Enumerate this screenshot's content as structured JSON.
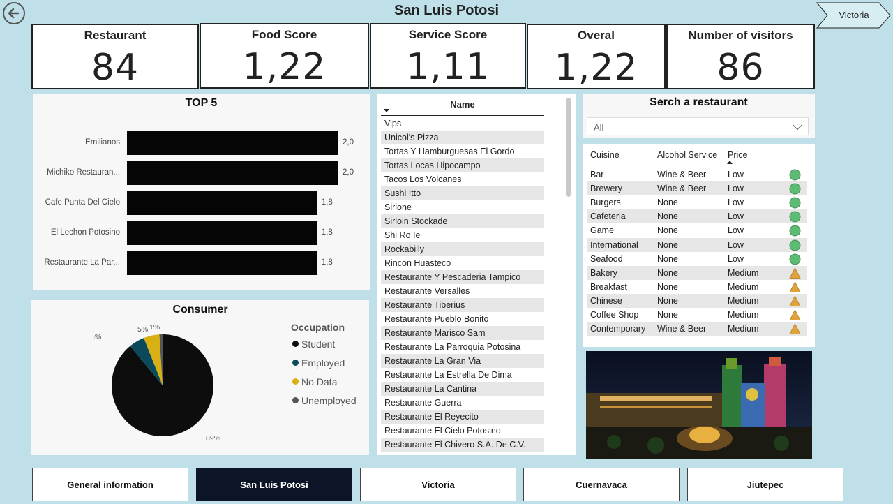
{
  "header": {
    "title": "San Luis Potosi",
    "nav_label": "Victoria"
  },
  "kpis": [
    {
      "label": "Restaurant",
      "value": "84"
    },
    {
      "label": "Food Score",
      "value": "1,22"
    },
    {
      "label": "Service Score",
      "value": "1,11"
    },
    {
      "label": "Overal",
      "value": "1,22"
    },
    {
      "label": "Number of visitors",
      "value": "86"
    }
  ],
  "top5": {
    "title": "TOP 5",
    "chart_data": {
      "type": "bar",
      "orientation": "horizontal",
      "categories": [
        "Emilianos",
        "Michiko Restauran...",
        "Cafe Punta Del Cielo",
        "El Lechon Potosino",
        "Restaurante La Par..."
      ],
      "values": [
        2.0,
        2.0,
        1.8,
        1.8,
        1.8
      ],
      "value_labels": [
        "2,0",
        "2,0",
        "1,8",
        "1,8",
        "1,8"
      ],
      "xlim": [
        0,
        2.0
      ],
      "color": "#050505"
    }
  },
  "consumer": {
    "title": "Consumer",
    "legend_title": "Occupation",
    "chart_data": {
      "type": "pie",
      "labels": [
        "Student",
        "Employed",
        "No Data",
        "Unemployed"
      ],
      "values": [
        89,
        5,
        5,
        1
      ],
      "value_labels": [
        "89%",
        "5%",
        "5%",
        "1%"
      ],
      "colors": [
        "#0d0d0d",
        "#0b4a5a",
        "#d9b014",
        "#555555"
      ],
      "legend_position": "right"
    }
  },
  "names": {
    "header": "Name",
    "rows": [
      "Vips",
      "Unicol's Pizza",
      "Tortas Y Hamburguesas El Gordo",
      "Tortas Locas Hipocampo",
      "Tacos Los Volcanes",
      "Sushi Itto",
      "Sirlone",
      "Sirloin Stockade",
      "Shi Ro Ie",
      "Rockabilly",
      "Rincon Huasteco",
      "Restaurante Y Pescaderia Tampico",
      "Restaurante Versalles",
      "Restaurante Tiberius",
      "Restaurante Pueblo Bonito",
      "Restaurante Marisco Sam",
      "Restaurante La Parroquia Potosina",
      "Restaurante La Gran Via",
      "Restaurante La Estrella De Dima",
      "Restaurante La Cantina",
      "Restaurante Guerra",
      "Restaurante El Reyecito",
      "Restaurante El Cielo Potosino",
      "Restaurante El Chivero S.A. De C.V."
    ]
  },
  "search": {
    "title": "Serch a restaurant",
    "selected": "All"
  },
  "cuisine_table": {
    "headers": [
      "Cuisine",
      "Alcohol Service",
      "Price"
    ],
    "rows": [
      {
        "cuisine": "Bar",
        "alcohol": "Wine & Beer",
        "price": "Low",
        "indicator": "green-circle"
      },
      {
        "cuisine": "Brewery",
        "alcohol": "Wine & Beer",
        "price": "Low",
        "indicator": "green-circle"
      },
      {
        "cuisine": "Burgers",
        "alcohol": "None",
        "price": "Low",
        "indicator": "green-circle"
      },
      {
        "cuisine": "Cafeteria",
        "alcohol": "None",
        "price": "Low",
        "indicator": "green-circle"
      },
      {
        "cuisine": "Game",
        "alcohol": "None",
        "price": "Low",
        "indicator": "green-circle"
      },
      {
        "cuisine": "International",
        "alcohol": "None",
        "price": "Low",
        "indicator": "green-circle"
      },
      {
        "cuisine": "Seafood",
        "alcohol": "None",
        "price": "Low",
        "indicator": "green-circle"
      },
      {
        "cuisine": "Bakery",
        "alcohol": "None",
        "price": "Medium",
        "indicator": "orange-triangle"
      },
      {
        "cuisine": "Breakfast",
        "alcohol": "None",
        "price": "Medium",
        "indicator": "orange-triangle"
      },
      {
        "cuisine": "Chinese",
        "alcohol": "None",
        "price": "Medium",
        "indicator": "orange-triangle"
      },
      {
        "cuisine": "Coffee Shop",
        "alcohol": "None",
        "price": "Medium",
        "indicator": "orange-triangle"
      },
      {
        "cuisine": "Contemporary",
        "alcohol": "Wine & Beer",
        "price": "Medium",
        "indicator": "orange-triangle"
      }
    ],
    "colors": {
      "green": "#5dbb74",
      "orange": "#e0a33c"
    }
  },
  "bottom_nav": [
    {
      "label": "General information",
      "active": false
    },
    {
      "label": "San Luis Potosi",
      "active": true
    },
    {
      "label": "Victoria",
      "active": false
    },
    {
      "label": "Cuernavaca",
      "active": false
    },
    {
      "label": "Jiutepec",
      "active": false
    }
  ]
}
